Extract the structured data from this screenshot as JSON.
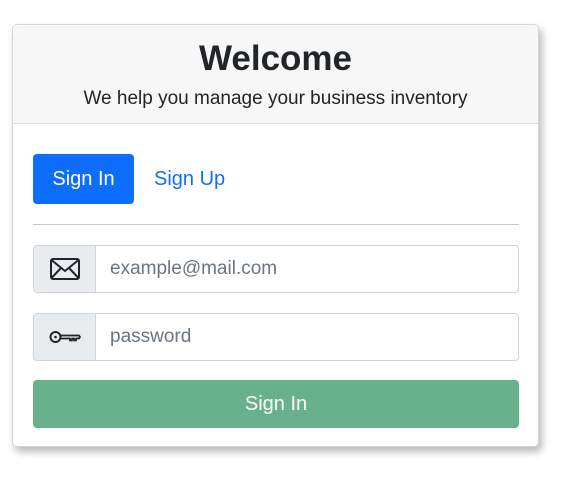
{
  "header": {
    "title": "Welcome",
    "subtitle": "We help you manage your business inventory"
  },
  "tabs": [
    {
      "label": "Sign In",
      "active": true
    },
    {
      "label": "Sign Up",
      "active": false
    }
  ],
  "form": {
    "email": {
      "icon": "envelope-icon",
      "placeholder": "example@mail.com",
      "value": ""
    },
    "password": {
      "icon": "key-icon",
      "placeholder": "password",
      "value": ""
    },
    "submit_label": "Sign In"
  },
  "colors": {
    "primary": "#0d6efd",
    "submit_disabled": "#69b08d",
    "header_bg": "#f7f7f7"
  }
}
